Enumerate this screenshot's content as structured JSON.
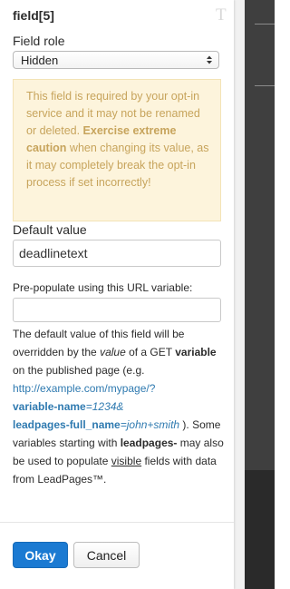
{
  "panel": {
    "title": "field[5]",
    "font_icon_glyph": "T"
  },
  "field_role": {
    "label": "Field role",
    "selected": "Hidden"
  },
  "warning": {
    "text_1": "This field is required by your opt-in service and it may not be renamed or deleted. ",
    "bold": "Exercise extreme caution",
    "text_2": " when changing its value, as it may completely break the opt-in process if set incorrectly!"
  },
  "default_value": {
    "label": "Default value",
    "value": "deadlinetext"
  },
  "url_variable": {
    "label": "Pre-populate using this URL variable:",
    "value": ""
  },
  "help": {
    "p1": "The default value of this field will be overridden by the ",
    "value_italic": "value",
    "p2": " of a GET ",
    "variable_bold": "variable",
    "p3": " on the published page (e.g. ",
    "url": "http://example.com/mypage/?",
    "param1_name": "variable-name",
    "param1_value": "=1234&",
    "param2_name": "leadpages-full_name",
    "param2_value": "=john+smith",
    "p4": " ). Some variables starting with ",
    "leadpages_bold": "leadpages-",
    "p5": " may also be used to populate ",
    "visible_underline": "visible",
    "p6": " fields with data from LeadPages™."
  },
  "buttons": {
    "ok": "Okay",
    "cancel": "Cancel"
  },
  "colors": {
    "primary": "#1b7ad2",
    "link": "#2f7ab0",
    "warning_bg": "#fdf4dc",
    "warning_text": "#c7a45c"
  }
}
